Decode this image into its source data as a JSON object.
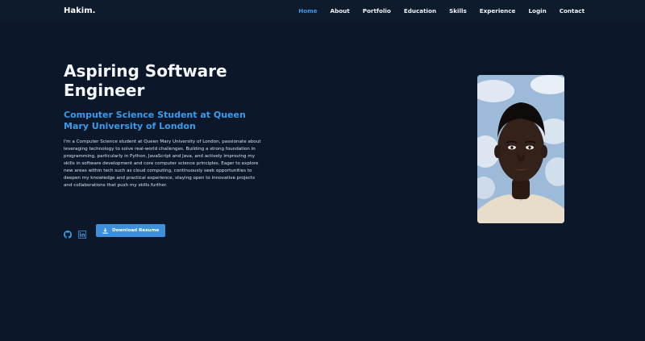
{
  "navbar": {
    "brand": "Hakim.",
    "links": [
      {
        "label": "Home",
        "active": true
      },
      {
        "label": "About",
        "active": false
      },
      {
        "label": "Portfolio",
        "active": false
      },
      {
        "label": "Education",
        "active": false
      },
      {
        "label": "Skills",
        "active": false
      },
      {
        "label": "Experience",
        "active": false
      },
      {
        "label": "Login",
        "active": false
      },
      {
        "label": "Contact",
        "active": false
      }
    ]
  },
  "hero": {
    "title": "Aspiring Software Engineer",
    "subtitle": "Computer Science Student at Queen Mary University of London",
    "bio": "I'm a Computer Science student at Queen Mary University of London, passionate about leveraging technology to solve real-world challenges. Building a strong foundation in programming, particularly in Python, JavaScript and Java, and actively improving my skills in software development and core computer science principles. Eager to explore new areas within tech such as cloud computing, continuously seek opportunities to deepen my knowledge and practical experience, staying open to innovative projects and collaborations that push my skills further.",
    "socials": [
      {
        "icon": "github-icon"
      },
      {
        "icon": "linkedin-icon"
      }
    ],
    "resume_button": {
      "label": "Download Resume",
      "icon": "download-icon"
    }
  },
  "profile": {
    "image": "profile-photo"
  },
  "colors": {
    "background": "#0c1829",
    "accent": "#3b9ae9",
    "button": "#3b8fdc",
    "text": "#e6edf6"
  }
}
